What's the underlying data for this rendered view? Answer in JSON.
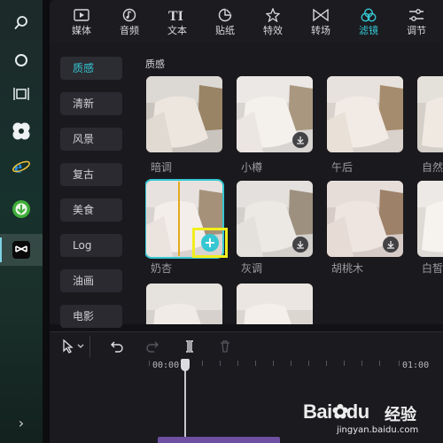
{
  "taskbar": {
    "icons": [
      "search-icon",
      "cortana-circle-icon",
      "task-view-icon",
      "pinwheel-app-icon",
      "ie-browser-icon",
      "download-app-icon",
      "capcut-app-icon"
    ],
    "active_index": 6
  },
  "toolbar": {
    "tabs": [
      {
        "label": "媒体",
        "icon": "media-icon"
      },
      {
        "label": "音频",
        "icon": "audio-icon"
      },
      {
        "label": "文本",
        "icon": "text-icon"
      },
      {
        "label": "贴纸",
        "icon": "sticker-icon"
      },
      {
        "label": "特效",
        "icon": "effects-icon"
      },
      {
        "label": "转场",
        "icon": "transition-icon"
      },
      {
        "label": "滤镜",
        "icon": "filter-icon"
      },
      {
        "label": "调节",
        "icon": "adjust-icon"
      }
    ],
    "active": "滤镜",
    "accent": "#35c7d2"
  },
  "filter_categories": [
    "质感",
    "清新",
    "风景",
    "复古",
    "美食",
    "Log",
    "油画",
    "电影"
  ],
  "active_category": "质感",
  "section_title": "质感",
  "filters": [
    {
      "name": "暗调",
      "downloaded": true
    },
    {
      "name": "小樽",
      "downloaded": false
    },
    {
      "name": "午后",
      "downloaded": true
    },
    {
      "name": "自然",
      "downloaded": true
    },
    {
      "name": "奶杏",
      "downloaded": true,
      "selected": true
    },
    {
      "name": "灰调",
      "downloaded": false
    },
    {
      "name": "胡桃木",
      "downloaded": false
    },
    {
      "name": "白皙",
      "downloaded": true
    }
  ],
  "timeline": {
    "ruler_start": "00:00",
    "ruler_end": "01:00"
  },
  "watermark": {
    "brand": "Bai",
    "brand2": "du",
    "cn": "经验",
    "sub": "jingyan.baidu.com"
  }
}
